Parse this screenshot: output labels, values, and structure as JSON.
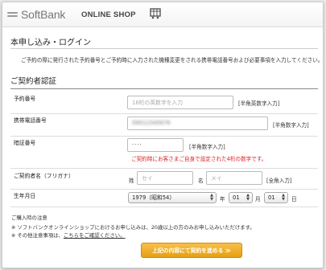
{
  "header": {
    "brand": "SoftBank",
    "shop": "ONLINE SHOP"
  },
  "page": {
    "title": "本申し込み・ログイン",
    "intro": "ご予約の際に発行された予約番号とご予約時に入力された機種変更をされる携帯電話番号および必要事項を入力してください。"
  },
  "section": {
    "title": "ご契約者認証"
  },
  "form": {
    "reservation_label": "予約番号",
    "reservation_placeholder": "16桁の英数字を入力",
    "reservation_note": "[半角英数字入力]",
    "phone_label": "携帯電話番号",
    "phone_value": "09012345678",
    "phone_note": "[半角数字入力]",
    "pin_label": "暗証番号",
    "pin_value": "····",
    "pin_note": "[半角数字入力]",
    "pin_hint": "ご契約時にお客さまご自身で設定された4桁の数字です。",
    "name_label": "ご契約者名（フリガナ）",
    "sei_label": "姓",
    "sei_placeholder": "セイ",
    "mei_label": "名",
    "mei_placeholder": "メイ",
    "name_note": "[全角入力]",
    "dob_label": "生年月日",
    "dob_year": "1979（昭和54）",
    "dob_year_unit": "年",
    "dob_month": "01",
    "dob_month_unit": "月",
    "dob_day": "01",
    "dob_day_unit": "日"
  },
  "notes": {
    "heading": "ご購入時の注意",
    "line1": "※ ソフトバンクオンラインショップにおけるお申し込みは、20歳以上の方のみお申し込みいただけます。",
    "line2_prefix": "※ その他注意事項は、",
    "line2_link": "こちらをご確認ください。"
  },
  "cta": {
    "label": "上記の内容にて契約を進める ≫"
  }
}
